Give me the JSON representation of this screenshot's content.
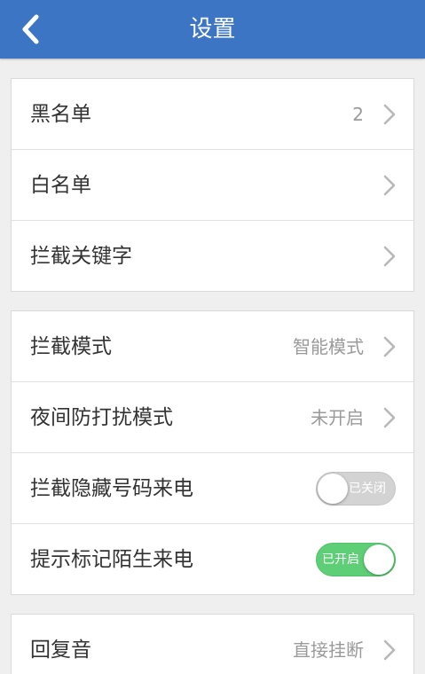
{
  "header": {
    "title": "设置",
    "back_icon": "chevron-left-icon",
    "color": "#3b75c4"
  },
  "group1": {
    "rows": [
      {
        "label": "黑名单",
        "value": "2"
      },
      {
        "label": "白名单"
      },
      {
        "label": "拦截关键字"
      }
    ]
  },
  "group2": {
    "rows": [
      {
        "label": "拦截模式",
        "value": "智能模式"
      },
      {
        "label": "夜间防打扰模式",
        "value": "未开启"
      },
      {
        "label": "拦截隐藏号码来电",
        "toggle_text": "已关闭",
        "toggle_state": "off"
      },
      {
        "label": "提示标记陌生来电",
        "toggle_text": "已开启",
        "toggle_state": "on"
      }
    ]
  },
  "group3": {
    "rows": [
      {
        "label": "回复音",
        "value": "直接挂断"
      }
    ]
  },
  "colors": {
    "toggle_on": "#5fcf77",
    "toggle_off": "#d3d3d3"
  }
}
